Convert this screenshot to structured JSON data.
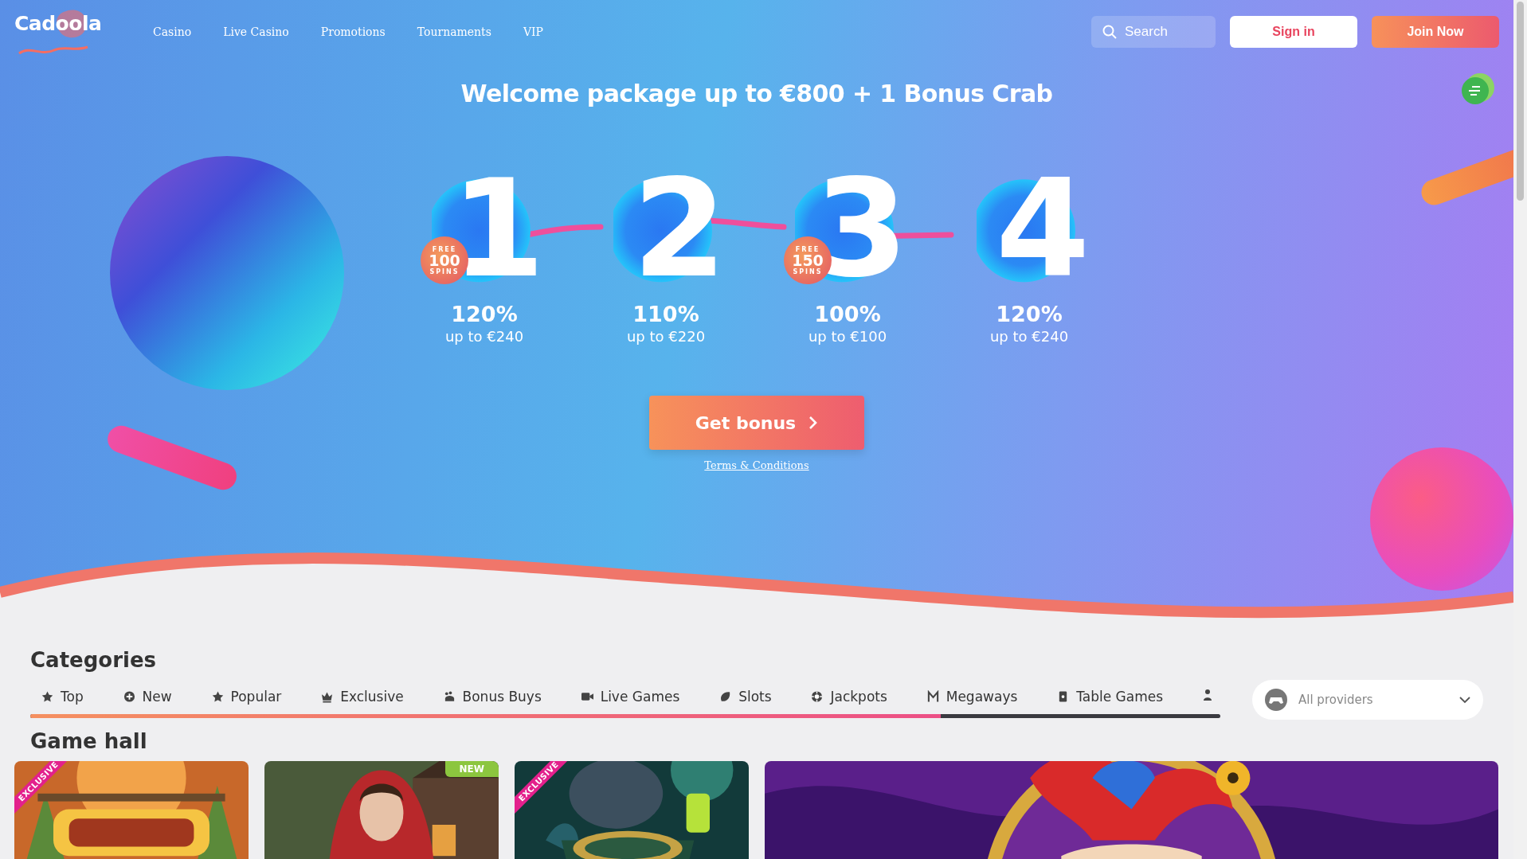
{
  "header": {
    "logo": "Cadoola",
    "nav": [
      {
        "label": "Casino"
      },
      {
        "label": "Live Casino"
      },
      {
        "label": "Promotions"
      },
      {
        "label": "Tournaments"
      },
      {
        "label": "VIP"
      }
    ],
    "search": {
      "placeholder": "Search"
    },
    "buttons": [
      {
        "kind": "secondary",
        "label": "Sign in"
      },
      {
        "kind": "primary",
        "label": "Join Now"
      }
    ]
  },
  "hero": {
    "title": "Welcome package up to €800 + 1 Bonus Crab",
    "steps": [
      {
        "number": "1",
        "percent": "120%",
        "cap": "up to €240",
        "free_spins": {
          "top": "FREE",
          "count": "100",
          "bottom": "SPINS"
        }
      },
      {
        "number": "2",
        "percent": "110%",
        "cap": "up to €220"
      },
      {
        "number": "3",
        "percent": "100%",
        "cap": "up to €100",
        "free_spins": {
          "top": "FREE",
          "count": "150",
          "bottom": "SPINS"
        }
      },
      {
        "number": "4",
        "percent": "120%",
        "cap": "up to €240"
      }
    ],
    "cta": "Get bonus",
    "terms": "Terms & Conditions"
  },
  "categories": {
    "title": "Categories",
    "tabs": [
      {
        "label": "Top"
      },
      {
        "label": "New"
      },
      {
        "label": "Popular"
      },
      {
        "label": "Exclusive"
      },
      {
        "label": "Bonus Buys"
      },
      {
        "label": "Live Games"
      },
      {
        "label": "Slots"
      },
      {
        "label": "Jackpots"
      },
      {
        "label": "Megaways"
      },
      {
        "label": "Table Games"
      }
    ],
    "providers": {
      "value": "All providers"
    }
  },
  "game_hall": {
    "title": "Game hall",
    "tiles": [
      {
        "kind": "picture",
        "badge": {
          "kind": "ribbon",
          "text": "EXCLUSIVE"
        }
      },
      {
        "kind": "picture",
        "badge": {
          "kind": "tag",
          "text": "NEW"
        }
      },
      {
        "kind": "picture",
        "badge": {
          "kind": "ribbon",
          "text": "EXCLUSIVE"
        }
      },
      {
        "kind": "picture"
      }
    ]
  }
}
